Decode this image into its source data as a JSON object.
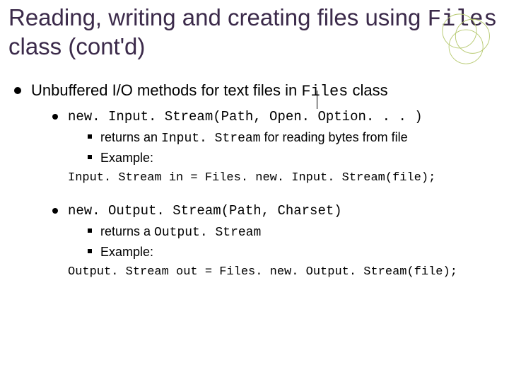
{
  "title": {
    "part1": "Reading, writing and creating files using ",
    "code": "Files",
    "part2": " class (cont'd)"
  },
  "main": {
    "lead": "Unbuffered I/O methods for text files in ",
    "lead_code": "Files",
    "lead_tail": " class"
  },
  "method1": {
    "signature": "new. Input. Stream(Path, Open. Option. . . )",
    "ret_pre": "returns an ",
    "ret_code": "Input. Stream",
    "ret_post": " for reading bytes from file",
    "example_label": "Example:",
    "code": "Input. Stream in = Files. new. Input. Stream(file);"
  },
  "method2": {
    "signature": "new. Output. Stream(Path, Charset)",
    "ret_pre": "returns a ",
    "ret_code": "Output. Stream",
    "example_label": "Example:",
    "code": "Output. Stream out = Files. new. Output. Stream(file);"
  }
}
